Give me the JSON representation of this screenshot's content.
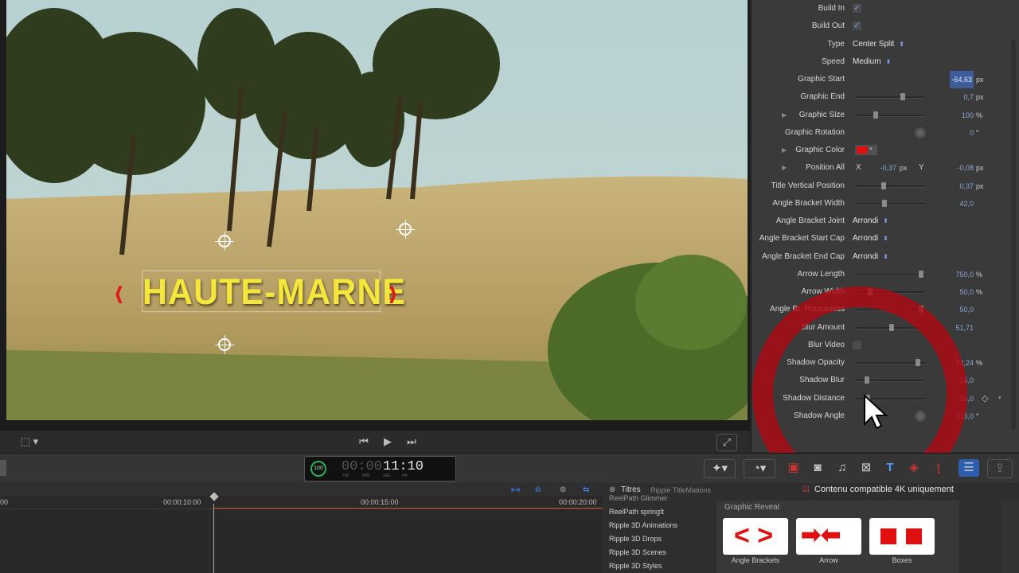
{
  "viewer": {
    "title_overlay": "HAUTE-MARNE",
    "bracket_left": "‹",
    "bracket_right": "›"
  },
  "inspector": {
    "build_in": {
      "label": "Build In",
      "checked": true
    },
    "build_out": {
      "label": "Build Out",
      "checked": true
    },
    "type": {
      "label": "Type",
      "value": "Center Split"
    },
    "speed": {
      "label": "Speed",
      "value": "Medium"
    },
    "graphic_start": {
      "label": "Graphic Start",
      "value": "-64,63",
      "unit": "px"
    },
    "graphic_end": {
      "label": "Graphic End",
      "value": "0,7",
      "unit": "px",
      "slider": 0.7
    },
    "graphic_size": {
      "label": "Graphic Size",
      "value": "100",
      "unit": "%",
      "slider": 0.28
    },
    "graphic_rotation": {
      "label": "Graphic Rotation",
      "value": "0",
      "unit": "°"
    },
    "graphic_color": {
      "label": "Graphic Color",
      "color": "#e01010"
    },
    "position_all": {
      "label": "Position All",
      "x_label": "X",
      "x": "-0,37",
      "x_unit": "px",
      "y_label": "Y",
      "y": "-0,08",
      "y_unit": "px"
    },
    "title_vertical_position": {
      "label": "Title Vertical Position",
      "value": "0,37",
      "unit": "px",
      "slider": 0.4
    },
    "angle_bracket_width": {
      "label": "Angle Bracket Width",
      "value": "42,0",
      "slider": 0.42
    },
    "angle_bracket_joint": {
      "label": "Angle Bracket Joint",
      "value": "Arrondi"
    },
    "angle_bracket_start_cap": {
      "label": "Angle Bracket Start Cap",
      "value": "Arrondi"
    },
    "angle_bracket_end_cap": {
      "label": "Angle Bracket End Cap",
      "value": "Arrondi"
    },
    "arrow_length": {
      "label": "Arrow Length",
      "value": "750,0",
      "unit": "%",
      "slider": 0.98
    },
    "arrow_width": {
      "label": "Arrow Width",
      "value": "50,0",
      "unit": "%",
      "slider": 0.2
    },
    "angle_br_roundness": {
      "label": "Angle Br. Roundness",
      "value": "50,0",
      "slider": 0.98
    },
    "blur_amount": {
      "label": "Blur Amount",
      "value": "51,71",
      "slider": 0.52
    },
    "blur_video": {
      "label": "Blur Video",
      "checked": false
    },
    "shadow_opacity": {
      "label": "Shadow Opacity",
      "value": "93,24",
      "unit": "%",
      "slider": 0.93
    },
    "shadow_blur": {
      "label": "Shadow Blur",
      "value": "15,0",
      "slider": 0.15
    },
    "shadow_distance": {
      "label": "Shadow Distance",
      "value": "16,0",
      "slider": 0.16
    },
    "shadow_angle": {
      "label": "Shadow Angle",
      "value": "315,0",
      "unit": "°"
    }
  },
  "toolbar": {
    "timecode": "11:10",
    "timecode_dim": "00:00",
    "timecode_units": [
      "HR",
      "MIN",
      "SEC",
      "FR"
    ],
    "percent": "100"
  },
  "timeline": {
    "ruler": [
      "00",
      "00:00:10:00",
      "00:00:15:00",
      "00:00:20:00"
    ]
  },
  "browser": {
    "tab": "Titres",
    "breadcrumb": "Ripple TitleMations",
    "filter_label": "Contenu compatible 4K uniquement",
    "category": "Graphic Reveal",
    "list": [
      "ReelPath Glimmer",
      "ReelPath springIt",
      "Ripple 3D Animations",
      "Ripple 3D Drops",
      "Ripple 3D Scenes",
      "Ripple 3D Styles"
    ],
    "thumbs": [
      "Angle Brackets",
      "Arrow",
      "Boxes"
    ]
  }
}
